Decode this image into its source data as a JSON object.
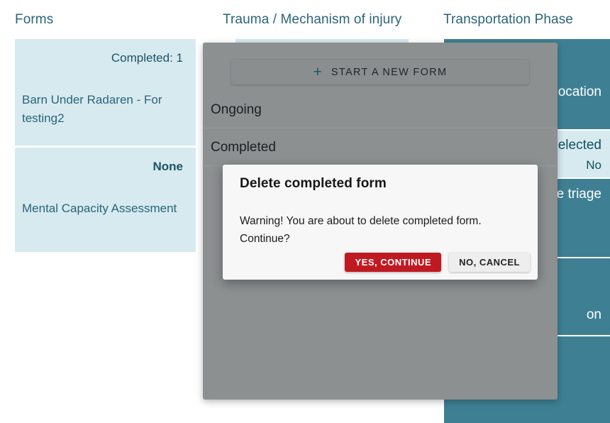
{
  "columns": {
    "forms": {
      "header": "Forms",
      "cards": [
        {
          "status": "Completed: 1",
          "status_bold": false,
          "title": "Barn Under Radaren - For testing2"
        },
        {
          "status": "None",
          "status_bold": true,
          "title": "Mental Capacity Assessment"
        }
      ]
    },
    "trauma": {
      "header": "Trauma / Mechanism of injury"
    },
    "transportation": {
      "header": "Transportation Phase",
      "cards": [
        {
          "style": "teal",
          "lines": [
            "location"
          ]
        },
        {
          "style": "light",
          "lines": [
            "elected",
            "No"
          ]
        },
        {
          "style": "teal",
          "lines": [
            "te triage"
          ]
        },
        {
          "style": "teal",
          "lines": [
            "on"
          ]
        },
        {
          "style": "teal",
          "lines": []
        }
      ]
    }
  },
  "overlay_panel": {
    "new_form_button": {
      "label": "START A NEW FORM",
      "icon": "plus-icon"
    },
    "sections": [
      {
        "heading": "Ongoing"
      },
      {
        "heading": "Completed"
      }
    ]
  },
  "modal": {
    "title": "Delete completed form",
    "message": "Warning! You are about to delete completed form. Continue?",
    "confirm_label": "YES, CONTINUE",
    "cancel_label": "NO, CANCEL"
  },
  "colors": {
    "card_light": "#d7eaf0",
    "card_teal": "#3e7f94",
    "header_text": "#2a6478",
    "overlay_scrim": "#8c9091",
    "danger": "#bf1a22",
    "modal_background": "#f7f7f7"
  }
}
